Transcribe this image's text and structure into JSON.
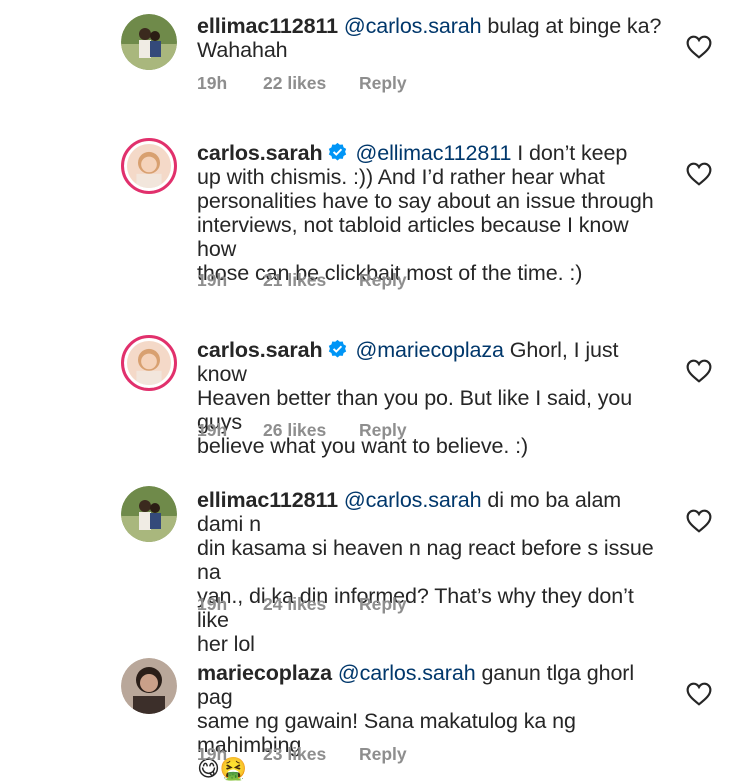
{
  "comments": [
    {
      "username": "ellimac112811",
      "verified": false,
      "mention": "@carlos.sarah",
      "lines": [
        "bulag at binge ka?",
        "Wahahah"
      ],
      "time": "19h",
      "likes": "22 likes",
      "reply": "Reply"
    },
    {
      "username": "carlos.sarah",
      "verified": true,
      "mention": "@ellimac112811",
      "lines": [
        "I don’t keep",
        "up with chismis. :)) And  I’d rather hear what",
        "personalities have to say about an issue through",
        "interviews, not tabloid articles because I know how",
        "those can be clickbait most of the time. :)"
      ],
      "time": "19h",
      "likes": "21 likes",
      "reply": "Reply"
    },
    {
      "username": "carlos.sarah",
      "verified": true,
      "mention": "@mariecoplaza",
      "lines": [
        "Ghorl, I just know",
        "Heaven better than you po. But like I said, you guys",
        "believe what you want to believe. :)"
      ],
      "time": "19h",
      "likes": "26 likes",
      "reply": "Reply"
    },
    {
      "username": "ellimac112811",
      "verified": false,
      "mention": "@carlos.sarah",
      "lines": [
        "di mo ba alam dami n",
        "din kasama si heaven n nag react before s issue na",
        "yan., di ka din informed? That’s why they don’t like",
        "her lol"
      ],
      "time": "19h",
      "likes": "24 likes",
      "reply": "Reply"
    },
    {
      "username": "mariecoplaza",
      "verified": false,
      "mention": "@carlos.sarah",
      "lines": [
        "ganun tlga ghorl pag",
        "same ng gawain! Sana makatulog ka ng mahimbing",
        "😋🤮"
      ],
      "time": "19h",
      "likes": "23 likes",
      "reply": "Reply"
    }
  ],
  "colors": {
    "text": "#262626",
    "mention": "#00376b",
    "meta": "#8e8e8e",
    "verified": "#0095f6"
  },
  "icons": {
    "like": "heart-outline-icon",
    "verified": "verified-badge-icon"
  }
}
